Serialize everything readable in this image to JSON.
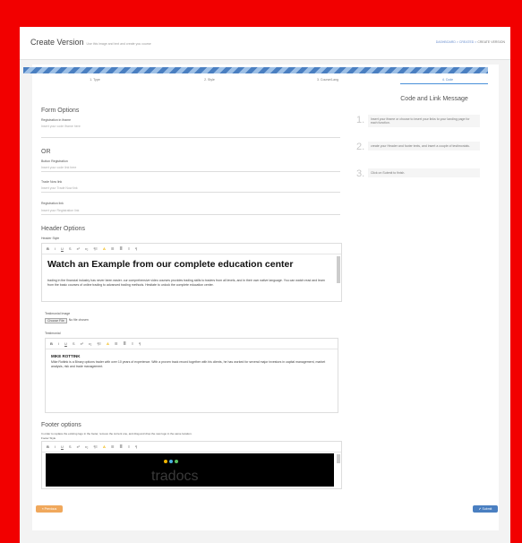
{
  "header": {
    "title": "Create Version",
    "subtitle": "Use this image and text and create you course",
    "breadcrumb": [
      "DASHBOARD",
      "CREATED",
      "CREATE VERSION"
    ]
  },
  "steps": [
    "1. Type",
    "2. Style",
    "3. Course/Lang",
    "4. Code"
  ],
  "form": {
    "form_options": "Form Options",
    "registration_iframe_label": "Registration in iframe",
    "registration_iframe_placeholder": "Insert your code iframe here",
    "or": "OR",
    "button_registration_label": "Button Registration",
    "button_registration_placeholder": "Insert your code link here",
    "trade_now_label": "Trade Now link",
    "trade_now_placeholder": "Insert your Trade Now link",
    "registration_link_label": "Registration link",
    "registration_link_placeholder": "Insert your Registration link"
  },
  "header_options": {
    "title": "Header Options",
    "header_style_label": "Header Style",
    "heading": "Watch an Example from our complete education center",
    "body": "trading in the financial industry has never been easier. our comprehensive video courses provides trading skills to traders from all levels, and in their own native language. You can watch read and learn from the basic courses of online trading to advanced trading methods. Hesitate to unlock the complete education center.",
    "testimonial_image_label": "Testimonial Image",
    "choose_file": "Choose File",
    "no_file": "No file chosen",
    "testimonial_label": "Testimonial",
    "testimonial_name": "MIKE ROTTINK",
    "testimonial_text": "Mike Rottink is a Binary options trader with over 10 years of experience. With a proven track record together with his clients, he has worked for several major investors in capital management, market analysis, risk and trade management."
  },
  "footer_options": {
    "title": "Footer options",
    "note": "In order to replace the existing logo in the footer, remove the current one, and drag and drop the new logo in the same location.",
    "footer_style_label": "Footer Style",
    "footer_logo_text": "tradocs"
  },
  "toolbar": {
    "items": [
      "B",
      "I",
      "U",
      "S",
      "x²",
      "x₂",
      "¶≡",
      "A",
      "☰",
      "≣",
      "≡",
      "¶"
    ]
  },
  "right": {
    "title": "Code and Link Message",
    "steps": [
      {
        "num": "1.",
        "text": "Insert your iframe or choose to insert your links to your landing page for each function."
      },
      {
        "num": "2.",
        "text": "create your Header and footer texts, and insert a couple of testimonials."
      },
      {
        "num": "3.",
        "text": "Click on Submit to finish."
      }
    ]
  },
  "buttons": {
    "previous": "Previous",
    "submit": "Submit"
  },
  "colors": {
    "frame": "#f20000",
    "accent": "#4a90d9",
    "previous": "#f0a85c",
    "submit": "#4a7fc1"
  }
}
